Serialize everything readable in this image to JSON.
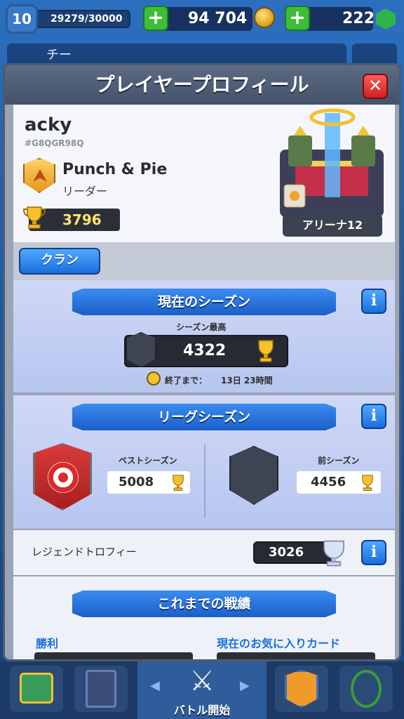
{
  "topbar": {
    "level": "10",
    "xp": "29279/30000",
    "gold": "94 704",
    "gems": "222",
    "plus_symbol": "+"
  },
  "background": {
    "clan_tab_partial": "チー"
  },
  "modal": {
    "title": "プレイヤープロフィール",
    "close_symbol": "✕"
  },
  "profile": {
    "name": "acky",
    "tag": "#G8QGR98Q",
    "clan_name": "Punch & Pie",
    "clan_role": "リーダー",
    "trophies": "3796",
    "arena": "アリーナ12"
  },
  "clan_button": {
    "label": "クラン"
  },
  "current_season": {
    "title": "現在のシーズン",
    "best_label": "シーズン最高",
    "best_value": "4322",
    "end_label": "終了まで：",
    "end_value": "13日 23時間",
    "info_symbol": "i"
  },
  "league_season": {
    "title": "リーグシーズン",
    "best_label": "ベストシーズン",
    "best_value": "5008",
    "prev_label": "前シーズン",
    "prev_value": "4456",
    "info_symbol": "i"
  },
  "legend": {
    "label": "レジェンドトロフィー",
    "value": "3026",
    "info_symbol": "i"
  },
  "history": {
    "title": "これまでの戦績",
    "wins_label": "勝利",
    "favorite_label": "現在のお気に入りカード"
  },
  "bottom_nav": {
    "battle_label": "バトル開始",
    "left_arrow": "◀",
    "right_arrow": "▶"
  },
  "colors": {
    "accent_blue": "#1a6ede",
    "trophy_gold": "#ffe56a",
    "close_red": "#d11f1f",
    "plus_green": "#3cbe3a"
  }
}
